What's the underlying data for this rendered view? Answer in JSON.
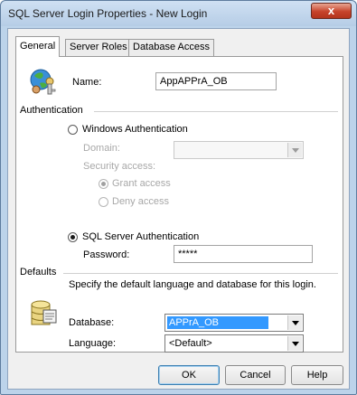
{
  "window": {
    "title": "SQL Server Login Properties - New Login",
    "close_glyph": "x"
  },
  "tabs": [
    {
      "label": "General"
    },
    {
      "label": "Server Roles"
    },
    {
      "label": "Database Access"
    }
  ],
  "name_field": {
    "label": "Name:",
    "value": "AppAPPrA_OB",
    "icon": "users-key-icon"
  },
  "authentication": {
    "group_label": "Authentication",
    "windows_label": "Windows Authentication",
    "domain_label": "Domain:",
    "security_access_label": "Security access:",
    "grant_label": "Grant access",
    "deny_label": "Deny access",
    "sql_label": "SQL Server Authentication",
    "password_label": "Password:",
    "password_value": "*****"
  },
  "defaults": {
    "group_label": "Defaults",
    "description": "Specify the default language and database for this login.",
    "database_label": "Database:",
    "database_value": "APPrA_OB",
    "language_label": "Language:",
    "language_value": "<Default>",
    "icon": "database-icon"
  },
  "buttons": {
    "ok": "OK",
    "cancel": "Cancel",
    "help": "Help"
  },
  "colors": {
    "selection": "#3399ff",
    "title_bar": "#bcd3ea",
    "close": "#c7432b"
  }
}
